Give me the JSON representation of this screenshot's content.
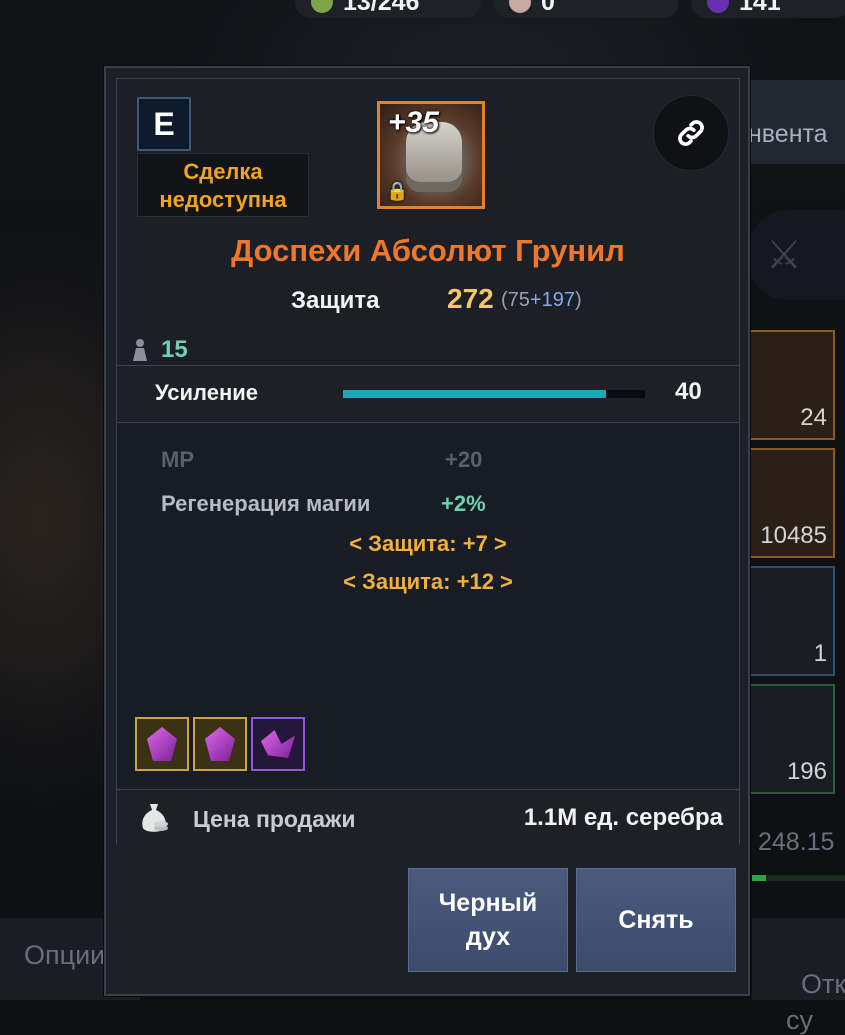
{
  "topbar": {
    "resources": [
      {
        "icon": "energy-icon",
        "value": "13/246"
      },
      {
        "icon": "pearl-icon",
        "value": "0"
      },
      {
        "icon": "crystal-icon",
        "value": "141"
      }
    ]
  },
  "side_panel": {
    "inventory_tab": "нвента",
    "slots": [
      {
        "qty": "24",
        "border": "orange"
      },
      {
        "qty": "10485",
        "border": "orange"
      },
      {
        "qty": "1",
        "border": "blue"
      },
      {
        "qty": "196",
        "border": "green"
      }
    ],
    "weight": "248.15"
  },
  "bottom": {
    "options_label": "Опции",
    "open_label": "Откр\nсу"
  },
  "tooltip": {
    "grade": "E",
    "trade_status": "Сделка недоступна",
    "item_level": "35",
    "item_name": "Доспехи Абсолют Грунил",
    "defense_label": "Защита",
    "defense_value": "272",
    "defense_base": "(75",
    "defense_bonus": "+197",
    "defense_close": ")",
    "weight": "15",
    "enhance_label": "Усиление",
    "enhance_value": "40",
    "enhance_progress": 0.87,
    "attr_mp_label": "MP",
    "attr_mp_value": "+20",
    "attr_regen_label": "Регенерация магии",
    "attr_regen_value": "+2%",
    "set_bonus_1": "< Защита: +7 >",
    "set_bonus_2": "< Защита: +12 >",
    "gems": [
      "gem-icon",
      "gem-icon",
      "broken-gem-icon"
    ],
    "price_label": "Цена продажи",
    "price_value": "1.1M ед. серебра",
    "btn_black_spirit": "Черный дух",
    "btn_unequip": "Снять"
  },
  "colors": {
    "item_name": "#f0762a",
    "trade_status": "#f0a520",
    "defense_value": "#f3c867",
    "enhance_bar": "#1fa6bd",
    "button_bg": "#4a5a7e"
  }
}
